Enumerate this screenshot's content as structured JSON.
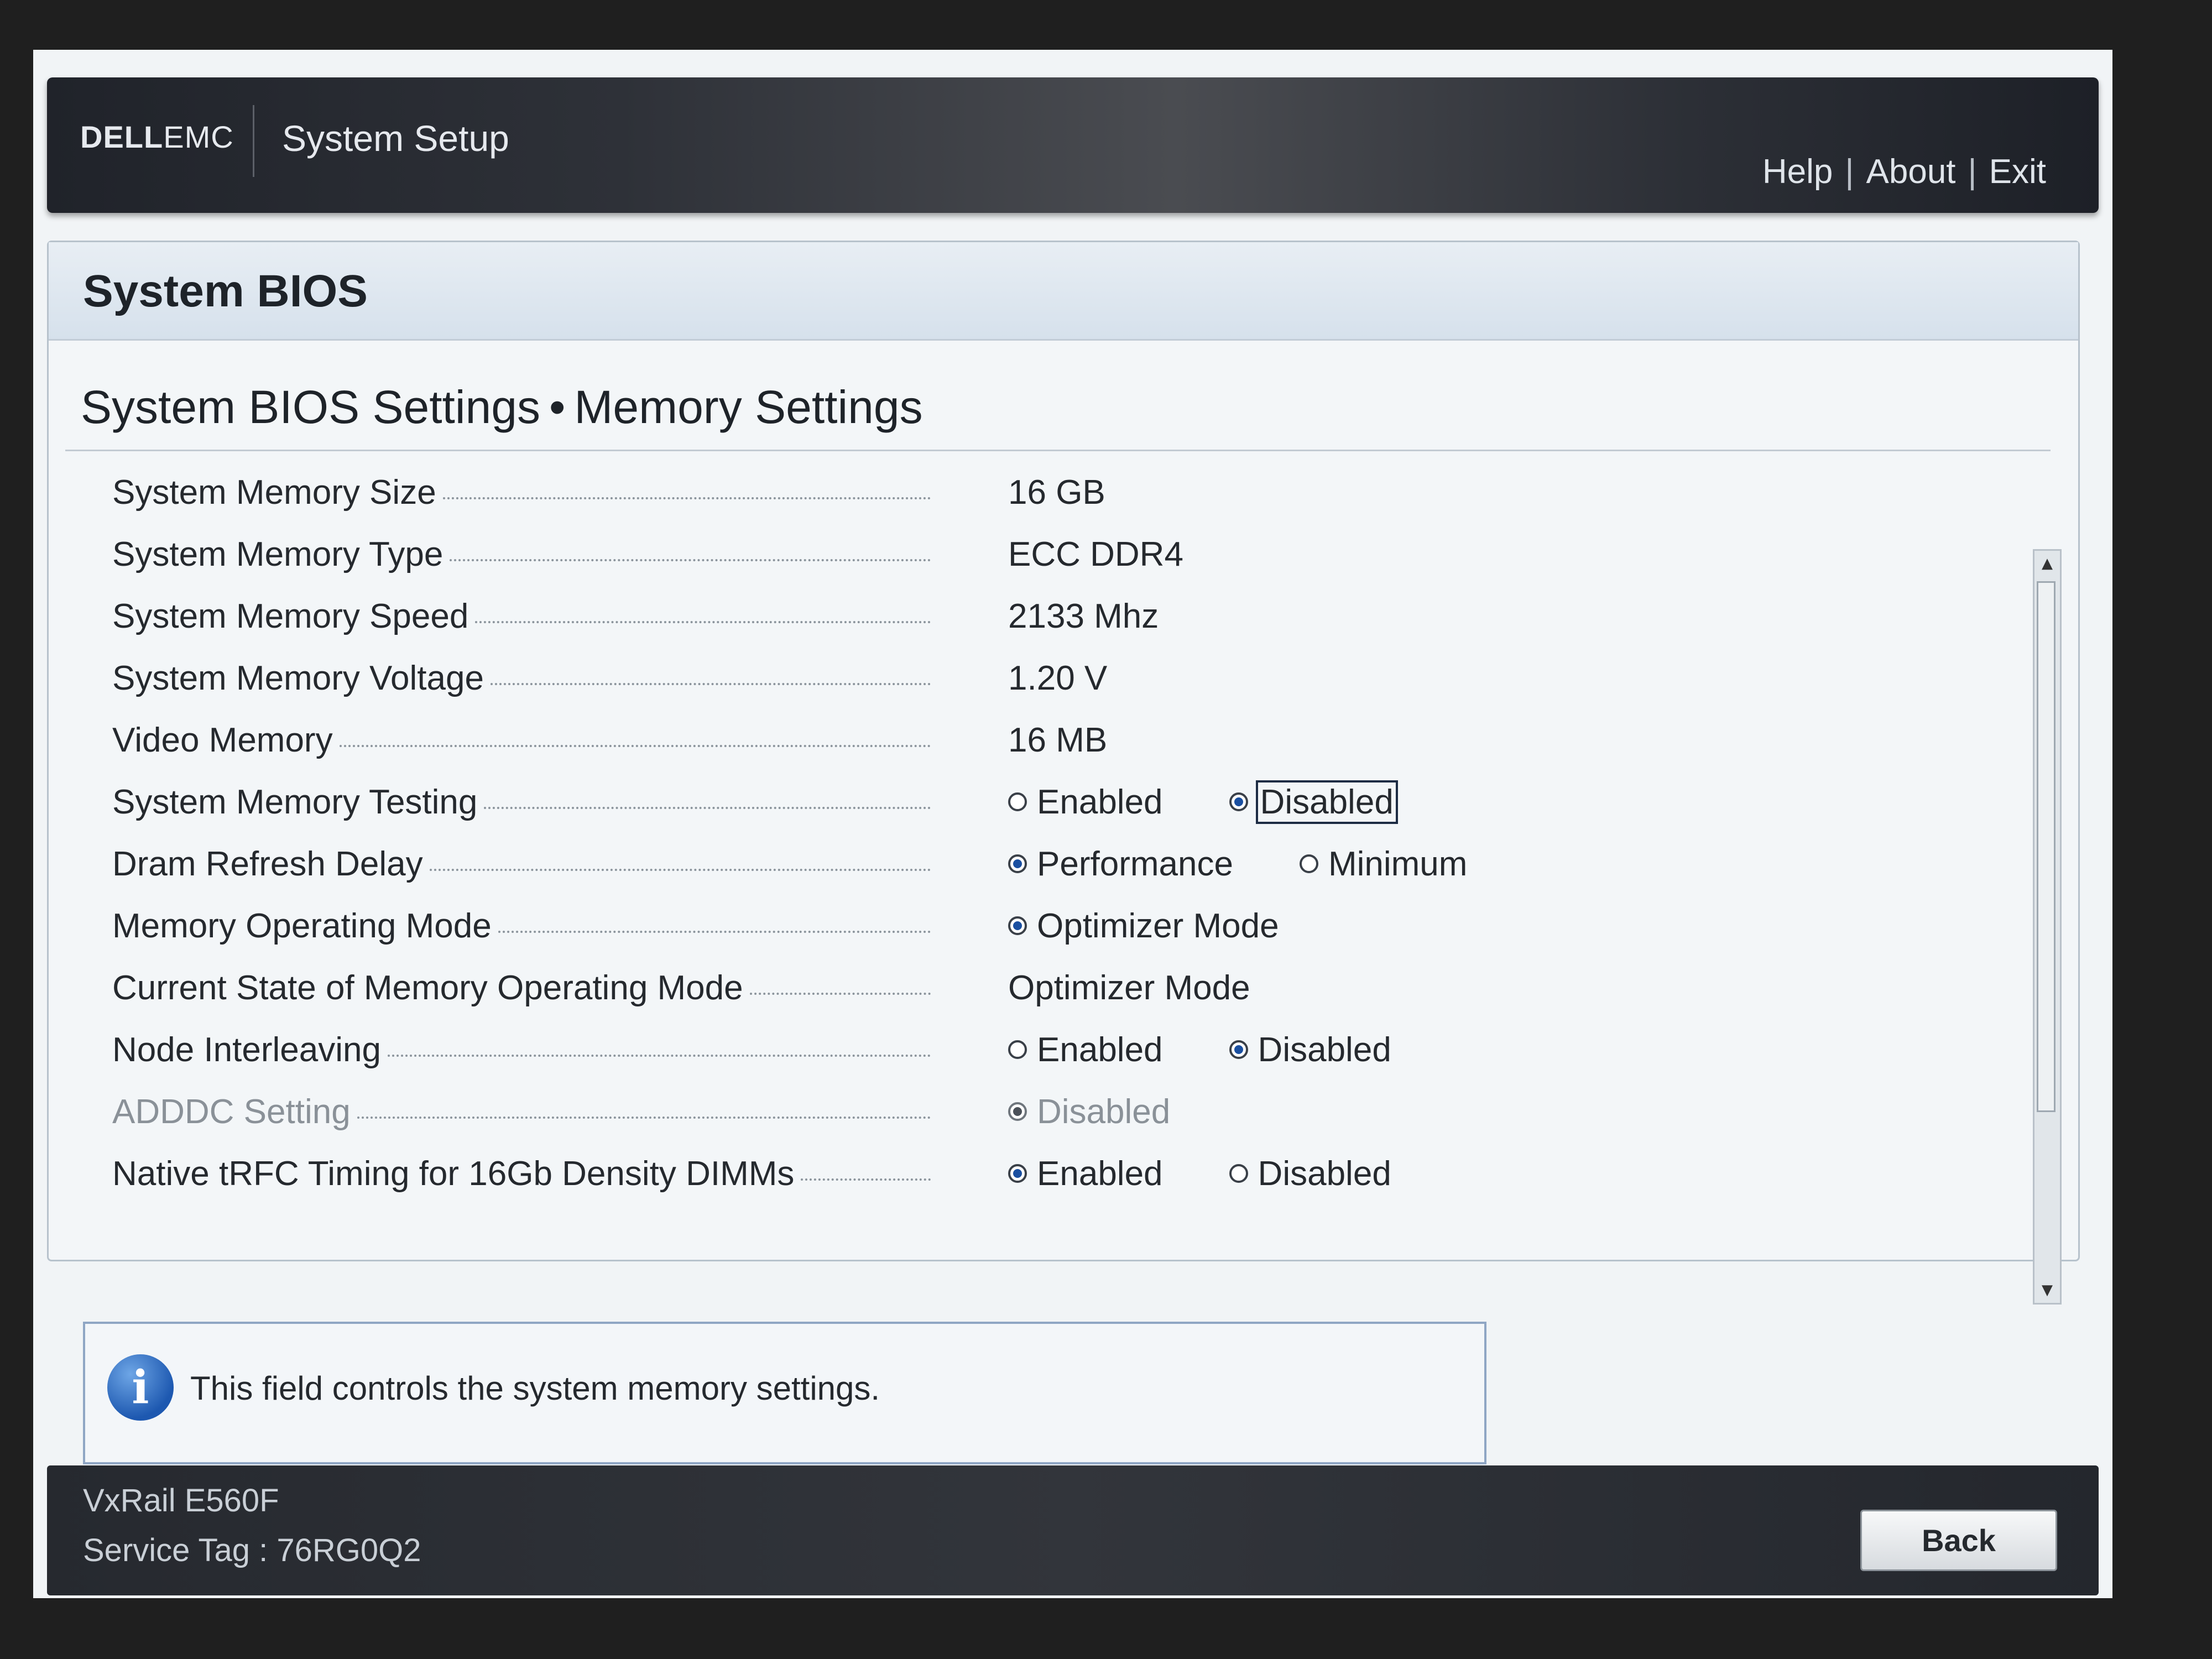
{
  "header": {
    "logo_primary": "DELL",
    "logo_secondary": "EMC",
    "app_title": "System Setup",
    "nav": {
      "help": "Help",
      "about": "About",
      "exit": "Exit",
      "separator": "|"
    }
  },
  "page": {
    "title": "System BIOS",
    "breadcrumb": {
      "parent": "System BIOS Settings",
      "separator": "•",
      "current": "Memory Settings"
    }
  },
  "settings": {
    "memory_size": {
      "label": "System Memory Size",
      "value": "16 GB"
    },
    "memory_type": {
      "label": "System Memory Type",
      "value": "ECC DDR4"
    },
    "memory_speed": {
      "label": "System Memory Speed",
      "value": "2133 Mhz"
    },
    "memory_voltage": {
      "label": "System Memory Voltage",
      "value": "1.20 V"
    },
    "video_memory": {
      "label": "Video Memory",
      "value": "16 MB"
    },
    "memory_testing": {
      "label": "System Memory Testing",
      "opt1": "Enabled",
      "opt2": "Disabled",
      "selected": "Disabled"
    },
    "dram_refresh": {
      "label": "Dram Refresh Delay",
      "opt1": "Performance",
      "opt2": "Minimum",
      "selected": "Performance"
    },
    "operating_mode": {
      "label": "Memory Operating Mode",
      "opt1": "Optimizer Mode",
      "selected": "Optimizer Mode"
    },
    "current_mode": {
      "label": "Current State of Memory Operating Mode",
      "value": "Optimizer Mode"
    },
    "node_interleaving": {
      "label": "Node Interleaving",
      "opt1": "Enabled",
      "opt2": "Disabled",
      "selected": "Disabled"
    },
    "adddc": {
      "label": "ADDDC Setting",
      "opt1": "Disabled",
      "selected": "Disabled"
    },
    "native_trfc": {
      "label": "Native tRFC Timing for 16Gb Density DIMMs",
      "opt1": "Enabled",
      "opt2": "Disabled",
      "selected": "Enabled"
    }
  },
  "info": {
    "icon": "info-icon",
    "icon_glyph": "i",
    "text": "This field controls the system memory settings."
  },
  "footer": {
    "model": "VxRail E560F",
    "service_tag": "Service Tag : 76RG0Q2",
    "back_label": "Back"
  },
  "colors": {
    "header_dark": "#2e3138",
    "radio_selected": "#1a4fa0",
    "panel_background": "#f3f6f8"
  }
}
